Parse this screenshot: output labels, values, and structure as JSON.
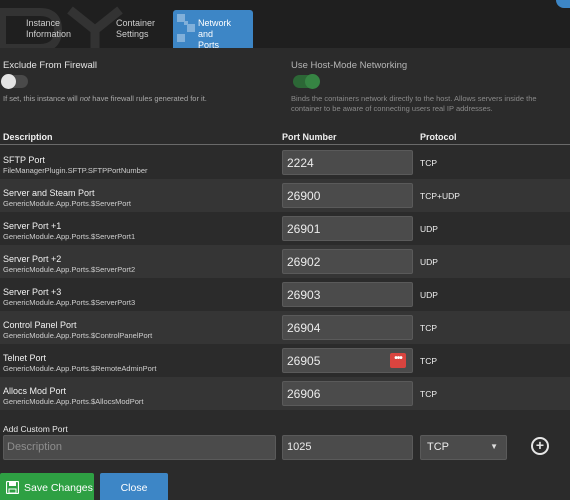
{
  "tabs": [
    {
      "label_line1": "Instance",
      "label_line2": "Information",
      "active": false
    },
    {
      "label_line1": "Container",
      "label_line2": "Settings",
      "active": false
    },
    {
      "label_line1": "Network and",
      "label_line2": "Ports",
      "active": true
    }
  ],
  "firewall": {
    "label": "Exclude From Firewall",
    "state": "off",
    "help_prefix": "If set, this instance will ",
    "help_emphasis": "not",
    "help_suffix": " have firewall rules generated for it."
  },
  "host_mode": {
    "label": "Use Host-Mode Networking",
    "state": "on",
    "help_line1": "Binds the containers network directly to the host. Allows servers inside the",
    "help_line2": "container to be aware of connecting users real IP addresses."
  },
  "table": {
    "headers": {
      "description": "Description",
      "port": "Port Number",
      "protocol": "Protocol"
    },
    "rows": [
      {
        "name": "SFTP Port",
        "key": "FileManagerPlugin.SFTP.SFTPPortNumber",
        "port": "2224",
        "protocol": "TCP"
      },
      {
        "name": "Server and Steam Port",
        "key": "GenericModule.App.Ports.$ServerPort",
        "port": "26900",
        "protocol": "TCP+UDP"
      },
      {
        "name": "Server Port +1",
        "key": "GenericModule.App.Ports.$ServerPort1",
        "port": "26901",
        "protocol": "UDP"
      },
      {
        "name": "Server Port +2",
        "key": "GenericModule.App.Ports.$ServerPort2",
        "port": "26902",
        "protocol": "UDP"
      },
      {
        "name": "Server Port +3",
        "key": "GenericModule.App.Ports.$ServerPort3",
        "port": "26903",
        "protocol": "UDP"
      },
      {
        "name": "Control Panel Port",
        "key": "GenericModule.App.Ports.$ControlPanelPort",
        "port": "26904",
        "protocol": "TCP"
      },
      {
        "name": "Telnet Port",
        "key": "GenericModule.App.Ports.$RemoteAdminPort",
        "port": "26905",
        "protocol": "TCP"
      },
      {
        "name": "Allocs Mod Port",
        "key": "GenericModule.App.Ports.$AllocsModPort",
        "port": "26906",
        "protocol": "TCP"
      }
    ]
  },
  "custom_port": {
    "label": "Add Custom Port",
    "description_placeholder": "Description",
    "port_value": "1025",
    "protocol_value": "TCP"
  },
  "buttons": {
    "save": "Save Changes",
    "close": "Close"
  },
  "icons": {
    "more": "more-dots-icon",
    "add": "plus-circle-icon",
    "save": "floppy-disk-icon"
  },
  "colors": {
    "accent_blue": "#3d86c6",
    "save_green": "#2ea043",
    "toggle_on": "#3aa24c",
    "danger_red": "#d9443f"
  }
}
